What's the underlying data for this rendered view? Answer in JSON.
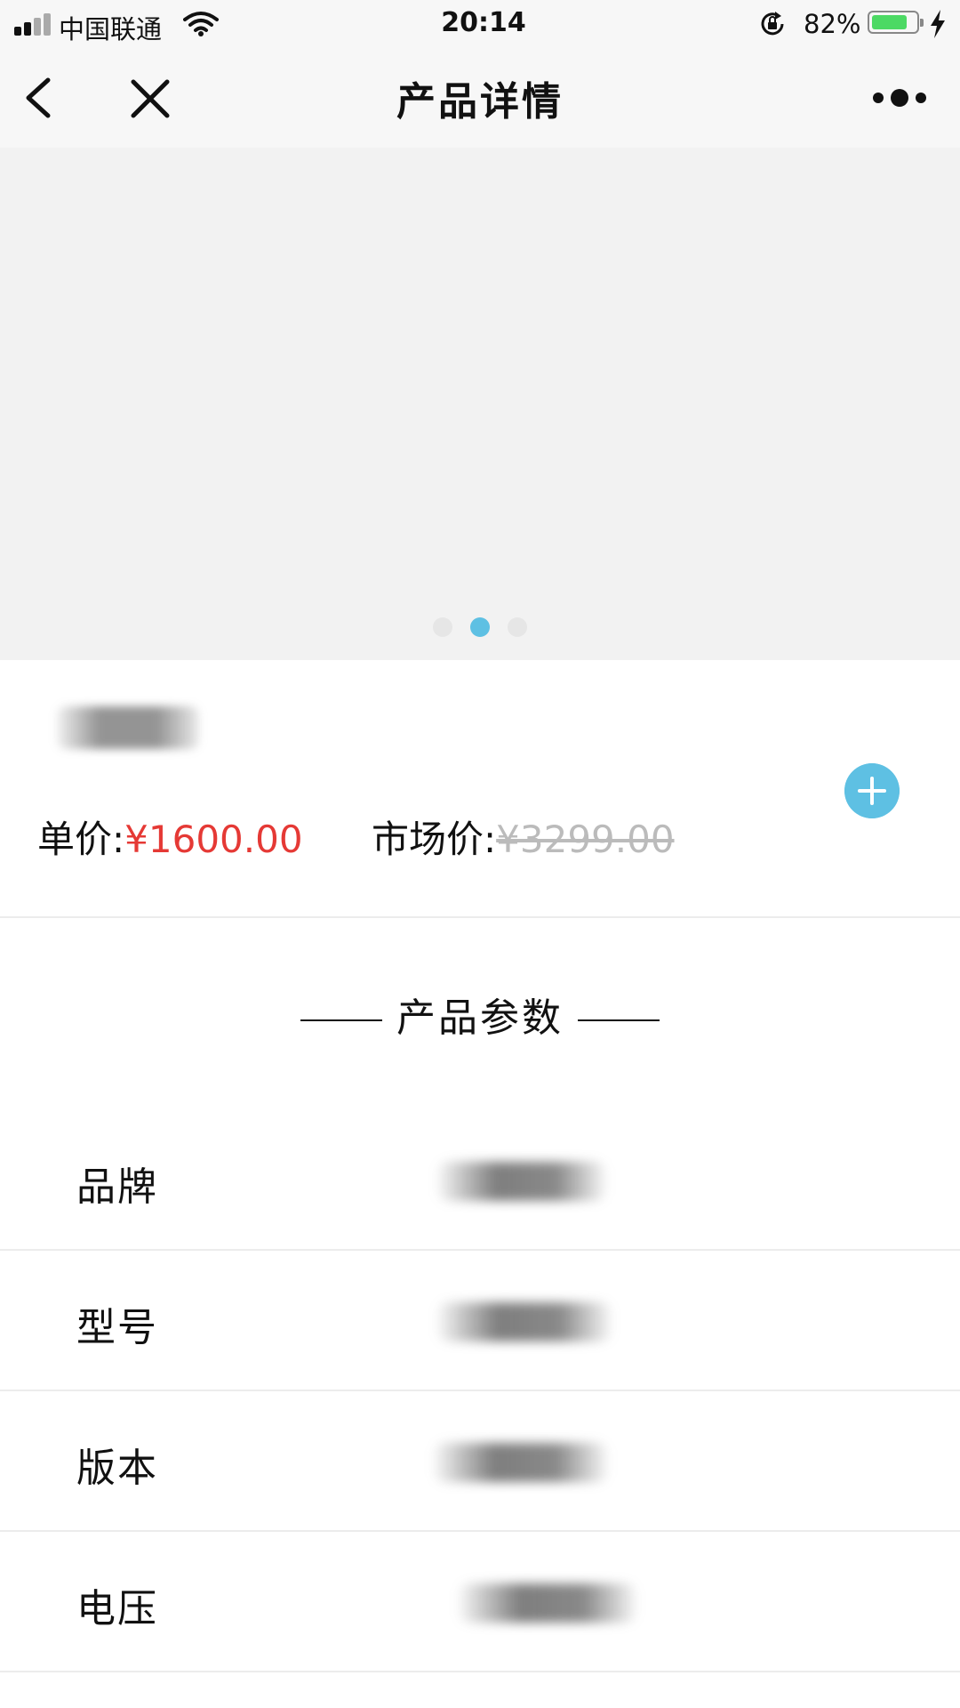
{
  "status_bar": {
    "carrier": "中国联通",
    "time": "20:14",
    "battery_percent": "82%",
    "battery_level": 0.82,
    "icons": [
      "signal-icon",
      "wifi-icon",
      "orientation-lock-icon",
      "battery-icon",
      "charging-bolt-icon"
    ]
  },
  "nav": {
    "title": "产品详情",
    "icons": [
      "back-icon",
      "close-icon",
      "more-icon"
    ]
  },
  "carousel": {
    "page_count": 3,
    "active_index": 1,
    "active_color": "#5ec0e3"
  },
  "product": {
    "unit_price_label": "单价:",
    "unit_price": "¥1600.00",
    "market_price_label": "市场价:",
    "market_price": "¥3299.00",
    "price_color": "#e53935",
    "add_icon": "plus-circle-icon"
  },
  "params_section": {
    "title": "产品参数",
    "rows": [
      {
        "label": "品牌"
      },
      {
        "label": "型号"
      },
      {
        "label": "版本"
      },
      {
        "label": "电压"
      }
    ]
  }
}
